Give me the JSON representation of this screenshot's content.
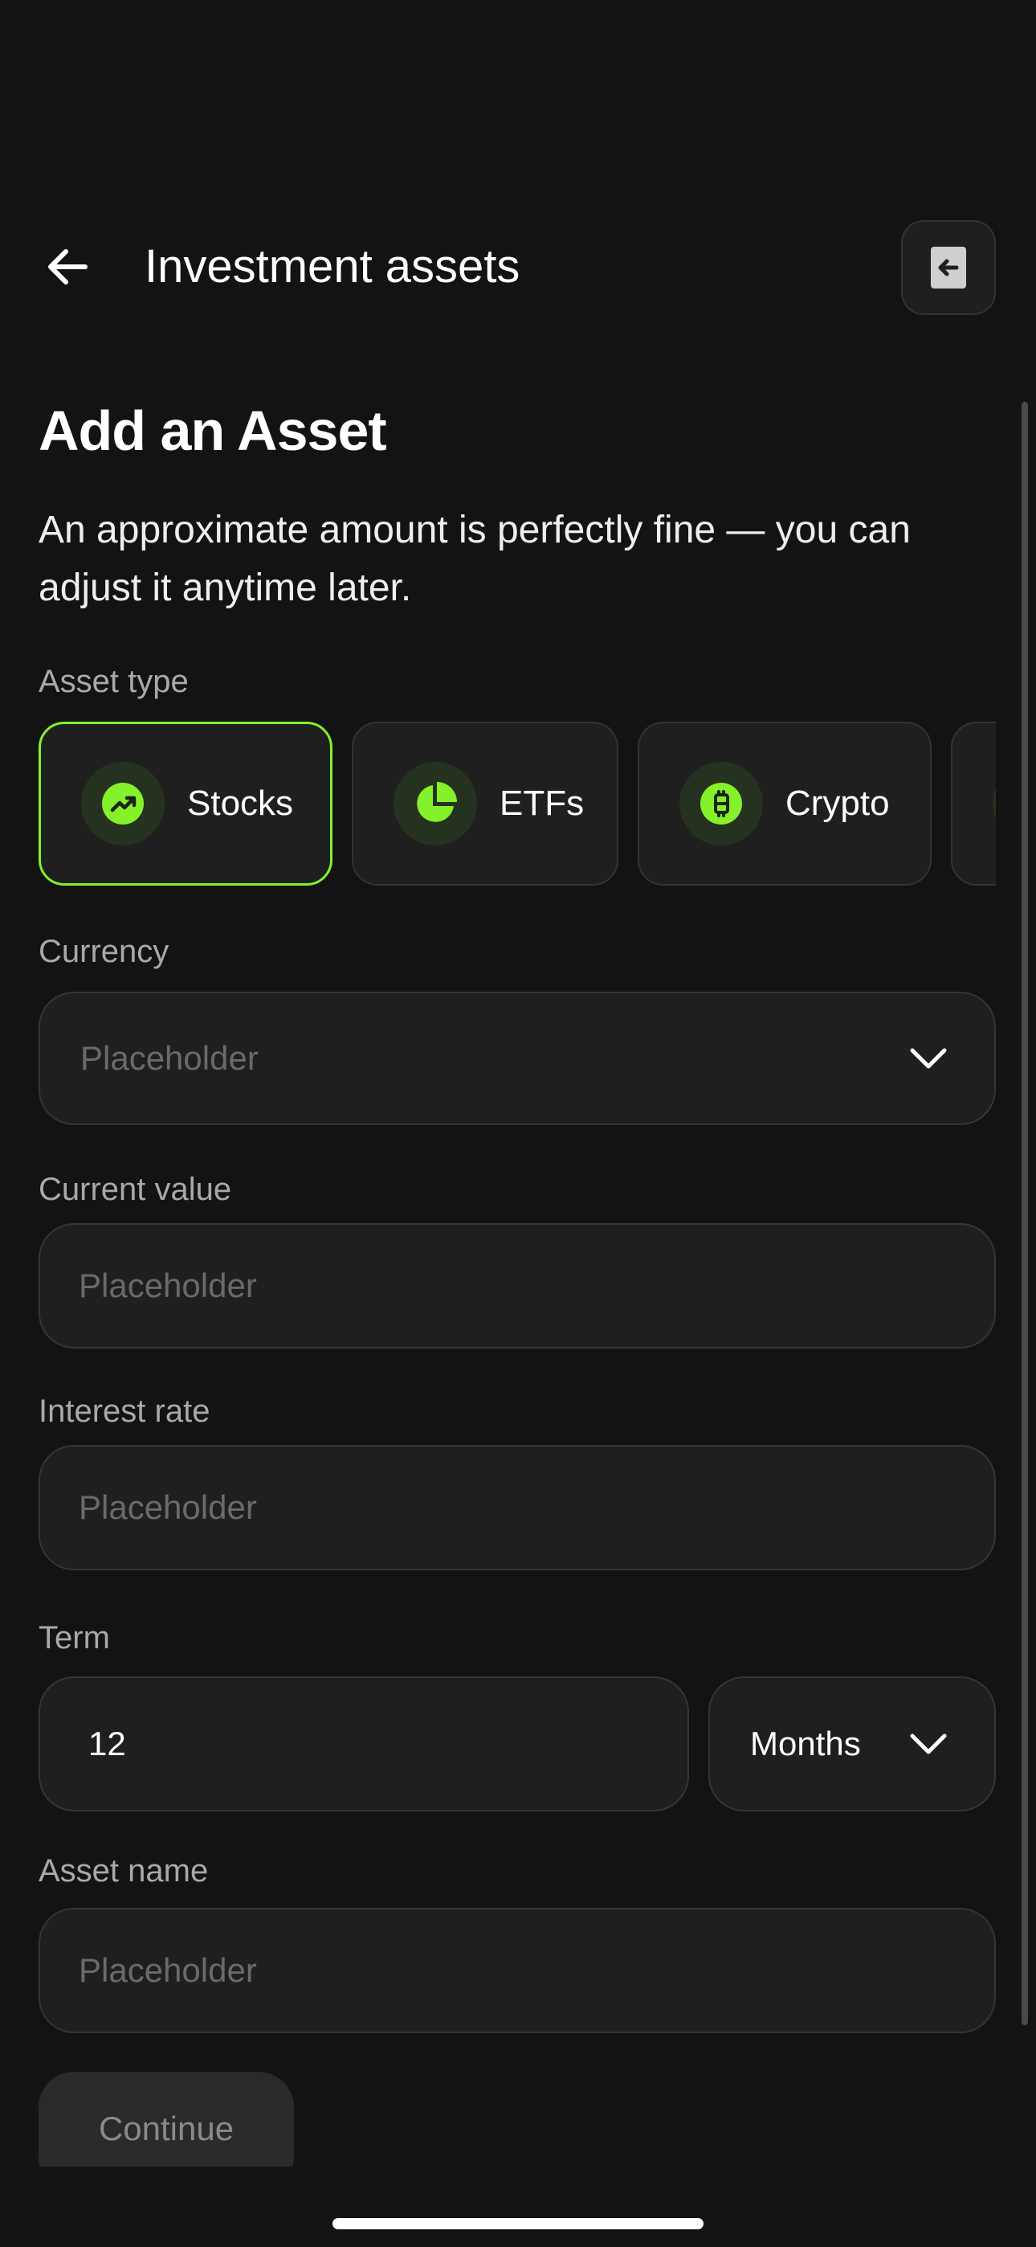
{
  "header": {
    "title": "Investment assets",
    "back_icon": "arrow-left-icon",
    "exit_icon": "exit-icon"
  },
  "form": {
    "title": "Add an Asset",
    "subtitle": "An approximate amount is perfectly fine — you can adjust it anytime later.",
    "asset_type": {
      "label": "Asset type",
      "options": [
        {
          "label": "Stocks",
          "icon": "trending-up-icon",
          "selected": true
        },
        {
          "label": "ETFs",
          "icon": "pie-chart-icon",
          "selected": false
        },
        {
          "label": "Crypto",
          "icon": "bitcoin-icon",
          "selected": false
        }
      ]
    },
    "currency": {
      "label": "Currency",
      "placeholder": "Placeholder",
      "icon": "chevron-down-icon"
    },
    "current_value": {
      "label": "Current value",
      "placeholder": "Placeholder"
    },
    "interest_rate": {
      "label": "Interest rate",
      "placeholder": "Placeholder"
    },
    "term": {
      "label": "Term",
      "value": "12",
      "unit": "Months",
      "icon": "chevron-down-icon"
    },
    "asset_name": {
      "label": "Asset name",
      "placeholder": "Placeholder"
    },
    "continue_label": "Continue"
  },
  "colors": {
    "background": "#131313",
    "surface": "#1f1f1f",
    "accent": "#84f12a",
    "border": "#333333"
  }
}
